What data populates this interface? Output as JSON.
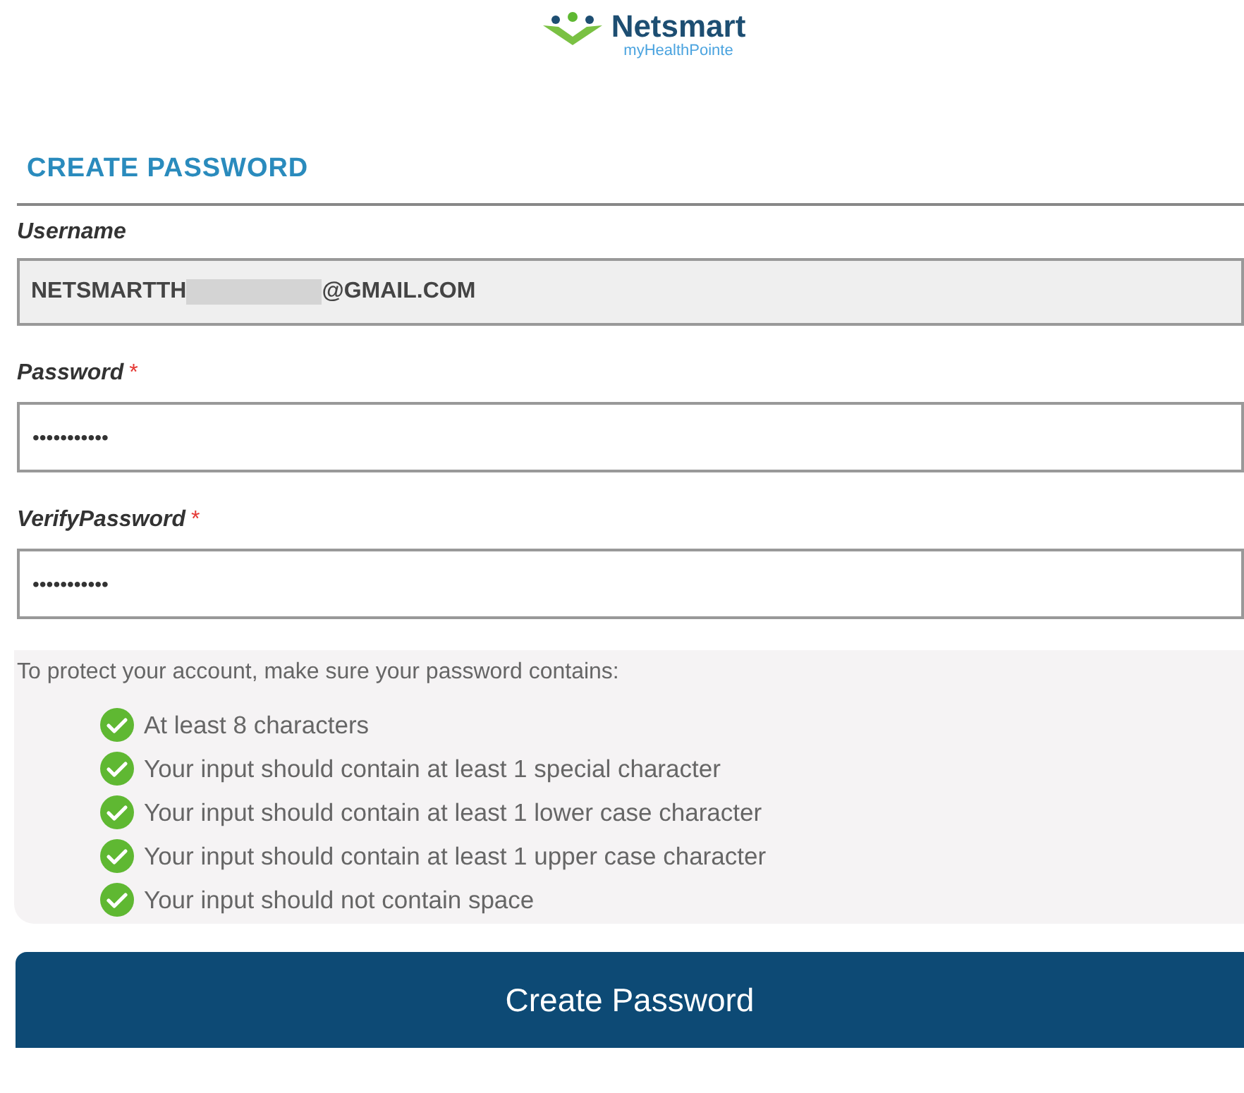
{
  "logo": {
    "name": "Netsmart",
    "tagline": "myHealthPointe"
  },
  "heading": "CREATE PASSWORD",
  "username": {
    "label": "Username",
    "value_start": "NETSMARTTH",
    "value_end": "@GMAIL.COM"
  },
  "fields": [
    {
      "label": "Password",
      "required_mark": "*",
      "value": "•••••••••••"
    },
    {
      "label": "VerifyPassword",
      "required_mark": "*",
      "value": "•••••••••••"
    }
  ],
  "rules": {
    "intro": "To protect your account, make sure your password contains:",
    "items": [
      {
        "text": "At least 8 characters",
        "met": true
      },
      {
        "text": "Your input should contain at least 1 special character",
        "met": true
      },
      {
        "text": "Your input should contain at least 1 lower case character",
        "met": true
      },
      {
        "text": "Your input should contain at least 1 upper case character",
        "met": true
      },
      {
        "text": "Your input should not contain space",
        "met": true
      }
    ]
  },
  "button": "Create Password"
}
